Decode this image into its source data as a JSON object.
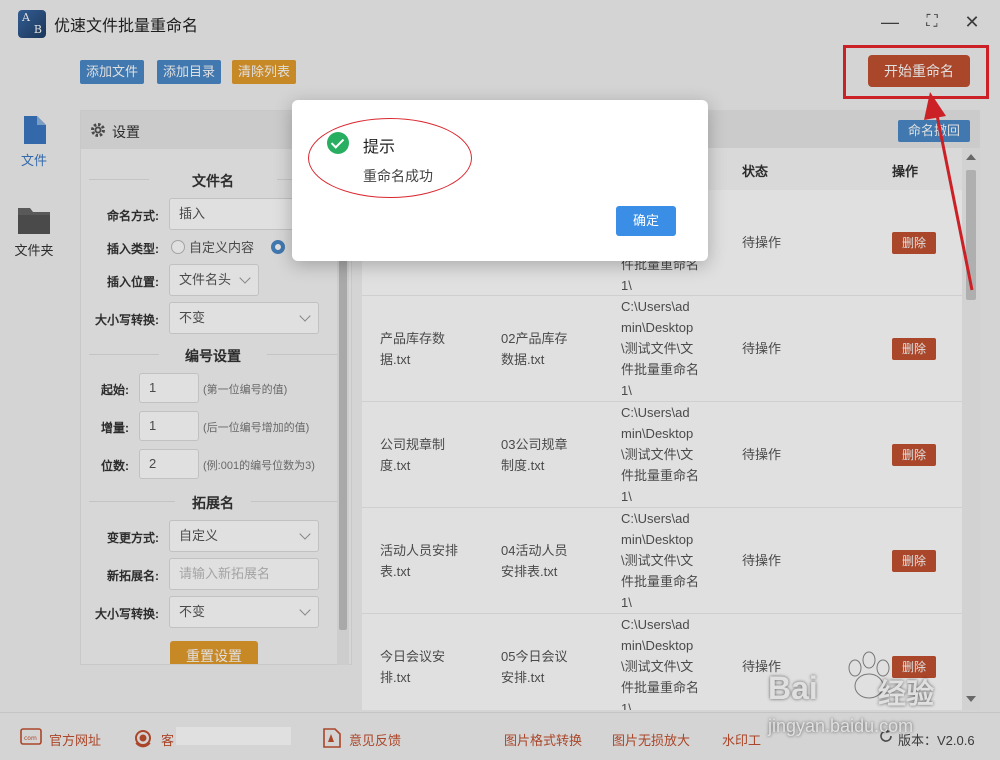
{
  "app": {
    "title": "优速文件批量重命名"
  },
  "toolbar": {
    "add_file": "添加文件",
    "add_dir": "添加目录",
    "clear_list": "清除列表",
    "start_rename": "开始重命名"
  },
  "nav": {
    "file": "文件",
    "folder": "文件夹"
  },
  "settings": {
    "title": "设置",
    "filename": {
      "section": "文件名",
      "mode_label": "命名方式:",
      "mode_value": "插入",
      "insert_type_label": "插入类型:",
      "insert_type_option1": "自定义内容",
      "insert_pos_label": "插入位置:",
      "insert_pos_value": "文件名头",
      "case_label": "大小写转换:",
      "case_value": "不变"
    },
    "numbering": {
      "section": "编号设置",
      "start_label": "起始:",
      "start_value": "1",
      "start_hint": "(第一位编号的值)",
      "step_label": "增量:",
      "step_value": "1",
      "step_hint": "(后一位编号增加的值)",
      "digits_label": "位数:",
      "digits_value": "2",
      "digits_hint": "(例:001的编号位数为3)"
    },
    "extension": {
      "section": "拓展名",
      "mode_label": "变更方式:",
      "mode_value": "自定义",
      "new_ext_label": "新拓展名:",
      "new_ext_placeholder": "请输入新拓展名",
      "case_label": "大小写转换:",
      "case_value": "不变"
    },
    "reset": "重置设置"
  },
  "table": {
    "undo": "命名撤回",
    "headers": {
      "status": "状态",
      "action": "操作"
    },
    "rows": [
      {
        "orig": "",
        "new": "",
        "path": "件批量重命名\n1\\",
        "status": "待操作",
        "action": "删除"
      },
      {
        "orig": "产品库存数\n据.txt",
        "new": "02产品库存\n数据.txt",
        "path": "C:\\Users\\ad\nmin\\Desktop\n\\测试文件\\文\n件批量重命名\n1\\",
        "status": "待操作",
        "action": "删除"
      },
      {
        "orig": "公司规章制\n度.txt",
        "new": "03公司规章\n制度.txt",
        "path": "C:\\Users\\ad\nmin\\Desktop\n\\测试文件\\文\n件批量重命名\n1\\",
        "status": "待操作",
        "action": "删除"
      },
      {
        "orig": "活动人员安排\n表.txt",
        "new": "04活动人员\n安排表.txt",
        "path": "C:\\Users\\ad\nmin\\Desktop\n\\测试文件\\文\n件批量重命名\n1\\",
        "status": "待操作",
        "action": "删除"
      },
      {
        "orig": "今日会议安\n排.txt",
        "new": "05今日会议\n安排.txt",
        "path": "C:\\Users\\ad\nmin\\Desktop\n\\测试文件\\文\n件批量重命名\n1\\",
        "status": "待操作",
        "action": "删除"
      }
    ]
  },
  "status_bar": {
    "website": "官方网址",
    "service": "客",
    "feedback": "意见反馈",
    "img_convert": "图片格式转换",
    "img_enlarge": "图片无损放大",
    "watermark": "水印工",
    "version": "版本：V2.0.6"
  },
  "dialog": {
    "title": "提示",
    "message": "重命名成功",
    "ok": "确定"
  },
  "watermark": {
    "brand": "Bai",
    "brand2": "经验",
    "site": "jingyan.baidu.com"
  },
  "colors": {
    "accent_blue": "#4a89c8",
    "accent_orange": "#e39b2c",
    "accent_red": "#c2502f",
    "annotation_red": "#e8262c",
    "success_green": "#27ae60"
  }
}
